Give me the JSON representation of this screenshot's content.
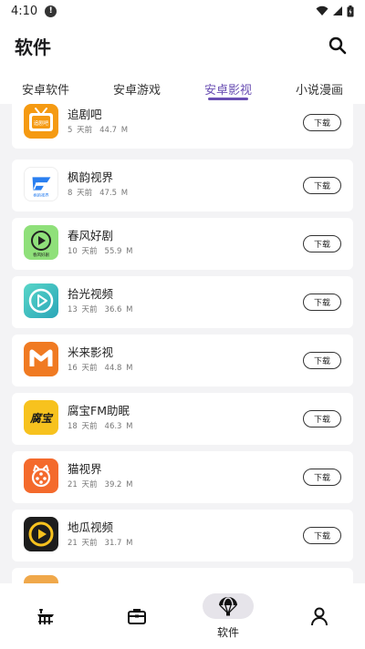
{
  "status_bar": {
    "time": "4:10"
  },
  "header": {
    "title": "软件"
  },
  "tabs": [
    {
      "label": "安卓软件"
    },
    {
      "label": "安卓游戏"
    },
    {
      "label": "安卓影视"
    },
    {
      "label": "小说漫画"
    }
  ],
  "active_tab": "安卓影视",
  "download_label": "下载",
  "apps": [
    {
      "name": "追剧吧",
      "age": "5 天前",
      "size": "44.7 M",
      "icon": "tv-icon",
      "icon_text": "追剧吧",
      "color": "#f59a12"
    },
    {
      "name": "枫韵视界",
      "age": "8 天前",
      "size": "47.5 M",
      "icon": "maple-logo-icon",
      "icon_text": "枫韵视界",
      "color": "#2a7ff0"
    },
    {
      "name": "春风好剧",
      "age": "10 天前",
      "size": "55.9 M",
      "icon": "play-circle-icon",
      "icon_text": "春风好剧",
      "color": "#8fe07a"
    },
    {
      "name": "拾光视频",
      "age": "13 天前",
      "size": "36.6 M",
      "icon": "play-circle-icon",
      "color": "#3cc4c0"
    },
    {
      "name": "米来影视",
      "age": "16 天前",
      "size": "44.8 M",
      "icon": "m-logo-icon",
      "color": "#f07a22"
    },
    {
      "name": "腐宝FM助眠",
      "age": "18 天前",
      "size": "46.3 M",
      "icon": "fubao-logo-icon",
      "icon_text": "腐宝",
      "color": "#f7c21e"
    },
    {
      "name": "猫视界",
      "age": "21 天前",
      "size": "39.2 M",
      "icon": "cat-film-icon",
      "color": "#f46a2c"
    },
    {
      "name": "地瓜视频",
      "age": "21 天前",
      "size": "31.7 M",
      "icon": "play-circle-icon",
      "color": "#1d1d1d"
    }
  ],
  "bottom_nav": [
    {
      "icon": "pier-icon",
      "label": ""
    },
    {
      "icon": "toolbox-icon",
      "label": ""
    },
    {
      "icon": "parachute-icon",
      "label": "软件"
    },
    {
      "icon": "person-icon",
      "label": ""
    }
  ],
  "accent_color": "#6a4fb3"
}
